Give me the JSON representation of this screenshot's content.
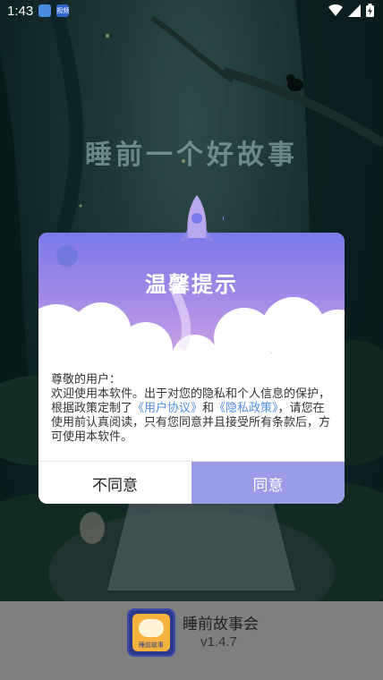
{
  "status_bar": {
    "time": "1:43",
    "app_badge_text": "视频"
  },
  "splash": {
    "title": "睡前一个好故事"
  },
  "dialog": {
    "title": "温馨提示",
    "greeting": "尊敬的用户：",
    "body_part1": "欢迎使用本软件。出于对您的隐私和个人信息的保护，根据政策定制了",
    "link_user_agreement": "《用户协议》",
    "body_and": "和",
    "link_privacy_policy": "《隐私政策》",
    "body_part2": "，请您在使用前认真阅读，只有您同意并且接受所有条款后，方可使用本软件。",
    "disagree_label": "不同意",
    "agree_label": "同意"
  },
  "app": {
    "name": "睡前故事会",
    "version": "v1.4.7",
    "logo_text": "睡前故事"
  },
  "colors": {
    "accent": "#9c9be8",
    "link": "#4f8de3"
  }
}
